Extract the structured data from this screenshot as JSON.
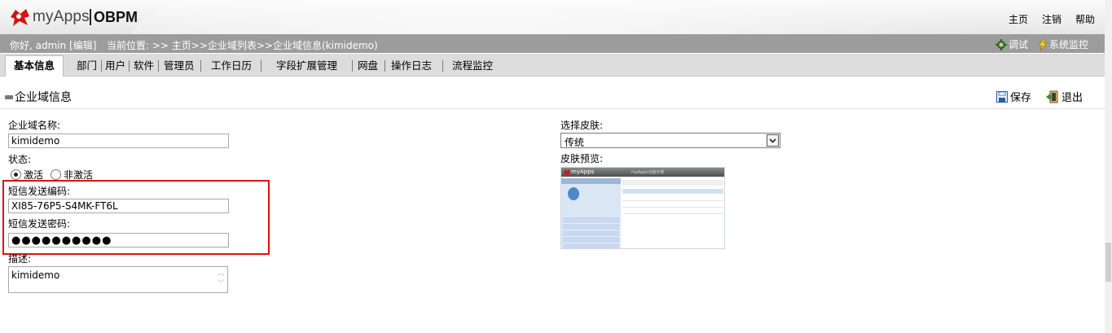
{
  "header": {
    "brand": "myApps",
    "product": "OBPM",
    "links": [
      "主页",
      "注销",
      "帮助"
    ]
  },
  "infobar": {
    "greeting": "你好, admin [编辑]",
    "location": "当前位置:  >> 主页>>企业域列表>>企业域信息(kimidemo)",
    "debug_label": "调试",
    "monitor_label": "系统监控"
  },
  "tabs": [
    {
      "label": "基本信息",
      "active": true
    },
    {
      "label": "部门"
    },
    {
      "label": "用户"
    },
    {
      "label": "软件"
    },
    {
      "label": "管理员"
    },
    {
      "label": "工作日历"
    },
    {
      "label": "字段扩展管理"
    },
    {
      "label": "网盘"
    },
    {
      "label": "操作日志"
    },
    {
      "label": "流程监控"
    }
  ],
  "section": {
    "title": "企业域信息",
    "save_label": "保存",
    "exit_label": "退出"
  },
  "form": {
    "domain_name_label": "企业域名称:",
    "domain_name_value": "kimidemo",
    "status_label": "状态:",
    "status_active": "激活",
    "status_inactive": "非激活",
    "sms_code_label": "短信发送编码:",
    "sms_code_value": "XI85-76P5-S4MK-FT6L",
    "sms_password_label": "短信发送密码:",
    "sms_password_mask": "●●●●●●●●●●",
    "desc_label": "描述:",
    "desc_value": "kimidemo",
    "skin_label": "选择皮肤:",
    "skin_value": "传统",
    "preview_label": "皮肤预览:"
  },
  "preview": {
    "brand": "myApps",
    "subtitle": "myApps功能示例"
  },
  "colors": {
    "infobar_bg": "#9c9c9c",
    "tabs_bg": "#dcdcdc",
    "highlight_box": "#e01010"
  }
}
